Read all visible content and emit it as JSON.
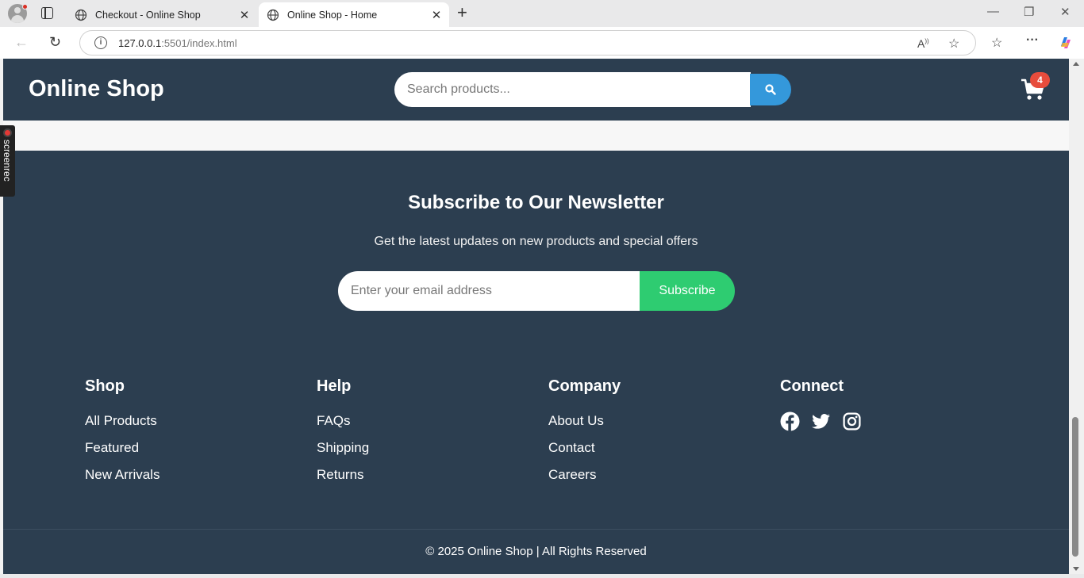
{
  "browser": {
    "tabs": [
      {
        "title": "Checkout - Online Shop",
        "active": false
      },
      {
        "title": "Online Shop - Home",
        "active": true
      }
    ],
    "url_host": "127.0.0.1",
    "url_rest": ":5501/index.html"
  },
  "header": {
    "logo": "Online Shop",
    "search_placeholder": "Search products...",
    "cart_count": "4"
  },
  "newsletter": {
    "title": "Subscribe to Our Newsletter",
    "subtitle": "Get the latest updates on new products and special offers",
    "email_placeholder": "Enter your email address",
    "button": "Subscribe"
  },
  "footer": {
    "columns": [
      {
        "title": "Shop",
        "links": [
          "All Products",
          "Featured",
          "New Arrivals"
        ]
      },
      {
        "title": "Help",
        "links": [
          "FAQs",
          "Shipping",
          "Returns"
        ]
      },
      {
        "title": "Company",
        "links": [
          "About Us",
          "Contact",
          "Careers"
        ]
      },
      {
        "title": "Connect",
        "social": [
          "facebook-icon",
          "twitter-icon",
          "instagram-icon"
        ]
      }
    ],
    "copyright": "© 2025 Online Shop | All Rights Reserved"
  },
  "overlay": {
    "screenrec_label": "screenrec"
  },
  "colors": {
    "header_bg": "#2c3e50",
    "search_button": "#3498db",
    "subscribe_button": "#2ecc71",
    "badge": "#e74c3c"
  }
}
